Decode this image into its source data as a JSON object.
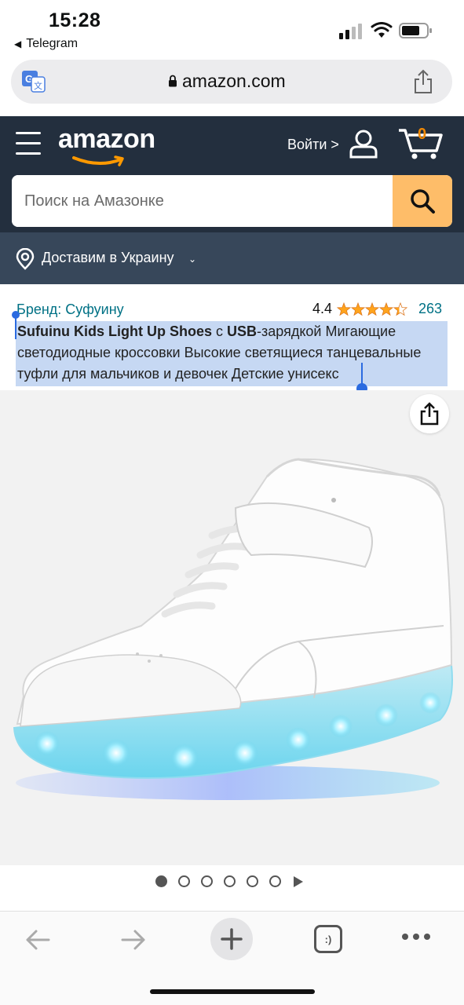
{
  "status": {
    "time": "15:28",
    "back_app": "Telegram"
  },
  "urlbar": {
    "domain": "amazon.com"
  },
  "header": {
    "logo": "amazon",
    "signin_label": "Войти >",
    "cart_count": "0",
    "search_placeholder": "Поиск на Амазонке",
    "deliver_text": "Доставим в Украину"
  },
  "product": {
    "brand": "Бренд: Суфуину",
    "rating": "4.4",
    "stars_filled": 4.4,
    "review_count": "263",
    "title_bold": "Sufuinu Kids Light Up Shoes",
    "title_mid": " с ",
    "title_bold2": "USB",
    "title_rest": "-зарядкой Мигающие светодиодные кроссовки Высокие светящиеся танцевальные туфли для мальчиков и девочек Детские унисекс"
  },
  "gallery": {
    "count": 6,
    "active_index": 0
  },
  "colors": {
    "header_bg": "#232f3e",
    "deliver_bg": "#37475a",
    "search_btn": "#febd69",
    "link": "#007185",
    "star": "#ffa41c",
    "selection": "#c6d8f3"
  },
  "toolbar": {
    "tabs_label": ":)"
  }
}
